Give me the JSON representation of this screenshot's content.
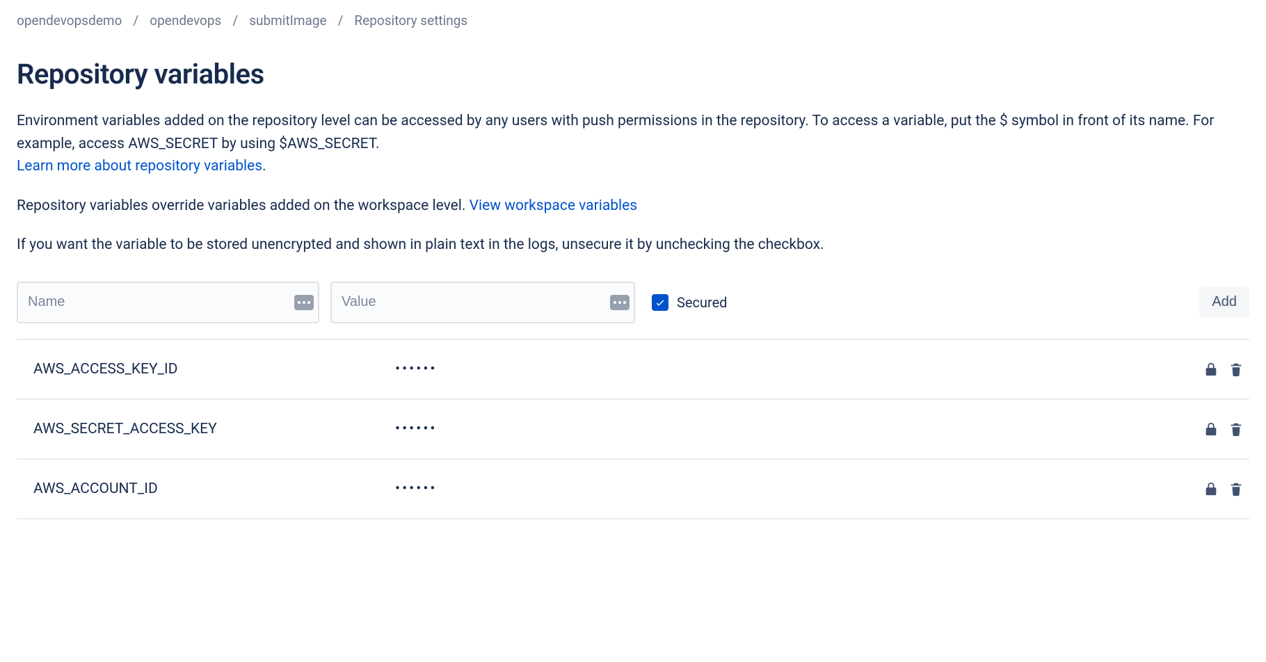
{
  "breadcrumb": {
    "items": [
      "opendevopsdemo",
      "opendevops",
      "submitImage",
      "Repository settings"
    ]
  },
  "title": "Repository variables",
  "desc1_a": "Environment variables added on the repository level can be accessed by any users with push permissions in the repository. To access a variable, put the $ symbol in front of its name. For example, access AWS_SECRET by using $AWS_SECRET.",
  "desc1_link": "Learn more about repository variables",
  "desc1_period": ".",
  "desc2_a": "Repository variables override variables added on the workspace level. ",
  "desc2_link": "View workspace variables",
  "desc3": "If you want the variable to be stored unencrypted and shown in plain text in the logs, unsecure it by unchecking the checkbox.",
  "form": {
    "name_placeholder": "Name",
    "value_placeholder": "Value",
    "secured_label": "Secured",
    "add_label": "Add"
  },
  "variables": [
    {
      "name": "AWS_ACCESS_KEY_ID",
      "value": "••••••"
    },
    {
      "name": "AWS_SECRET_ACCESS_KEY",
      "value": "••••••"
    },
    {
      "name": "AWS_ACCOUNT_ID",
      "value": "••••••"
    }
  ]
}
